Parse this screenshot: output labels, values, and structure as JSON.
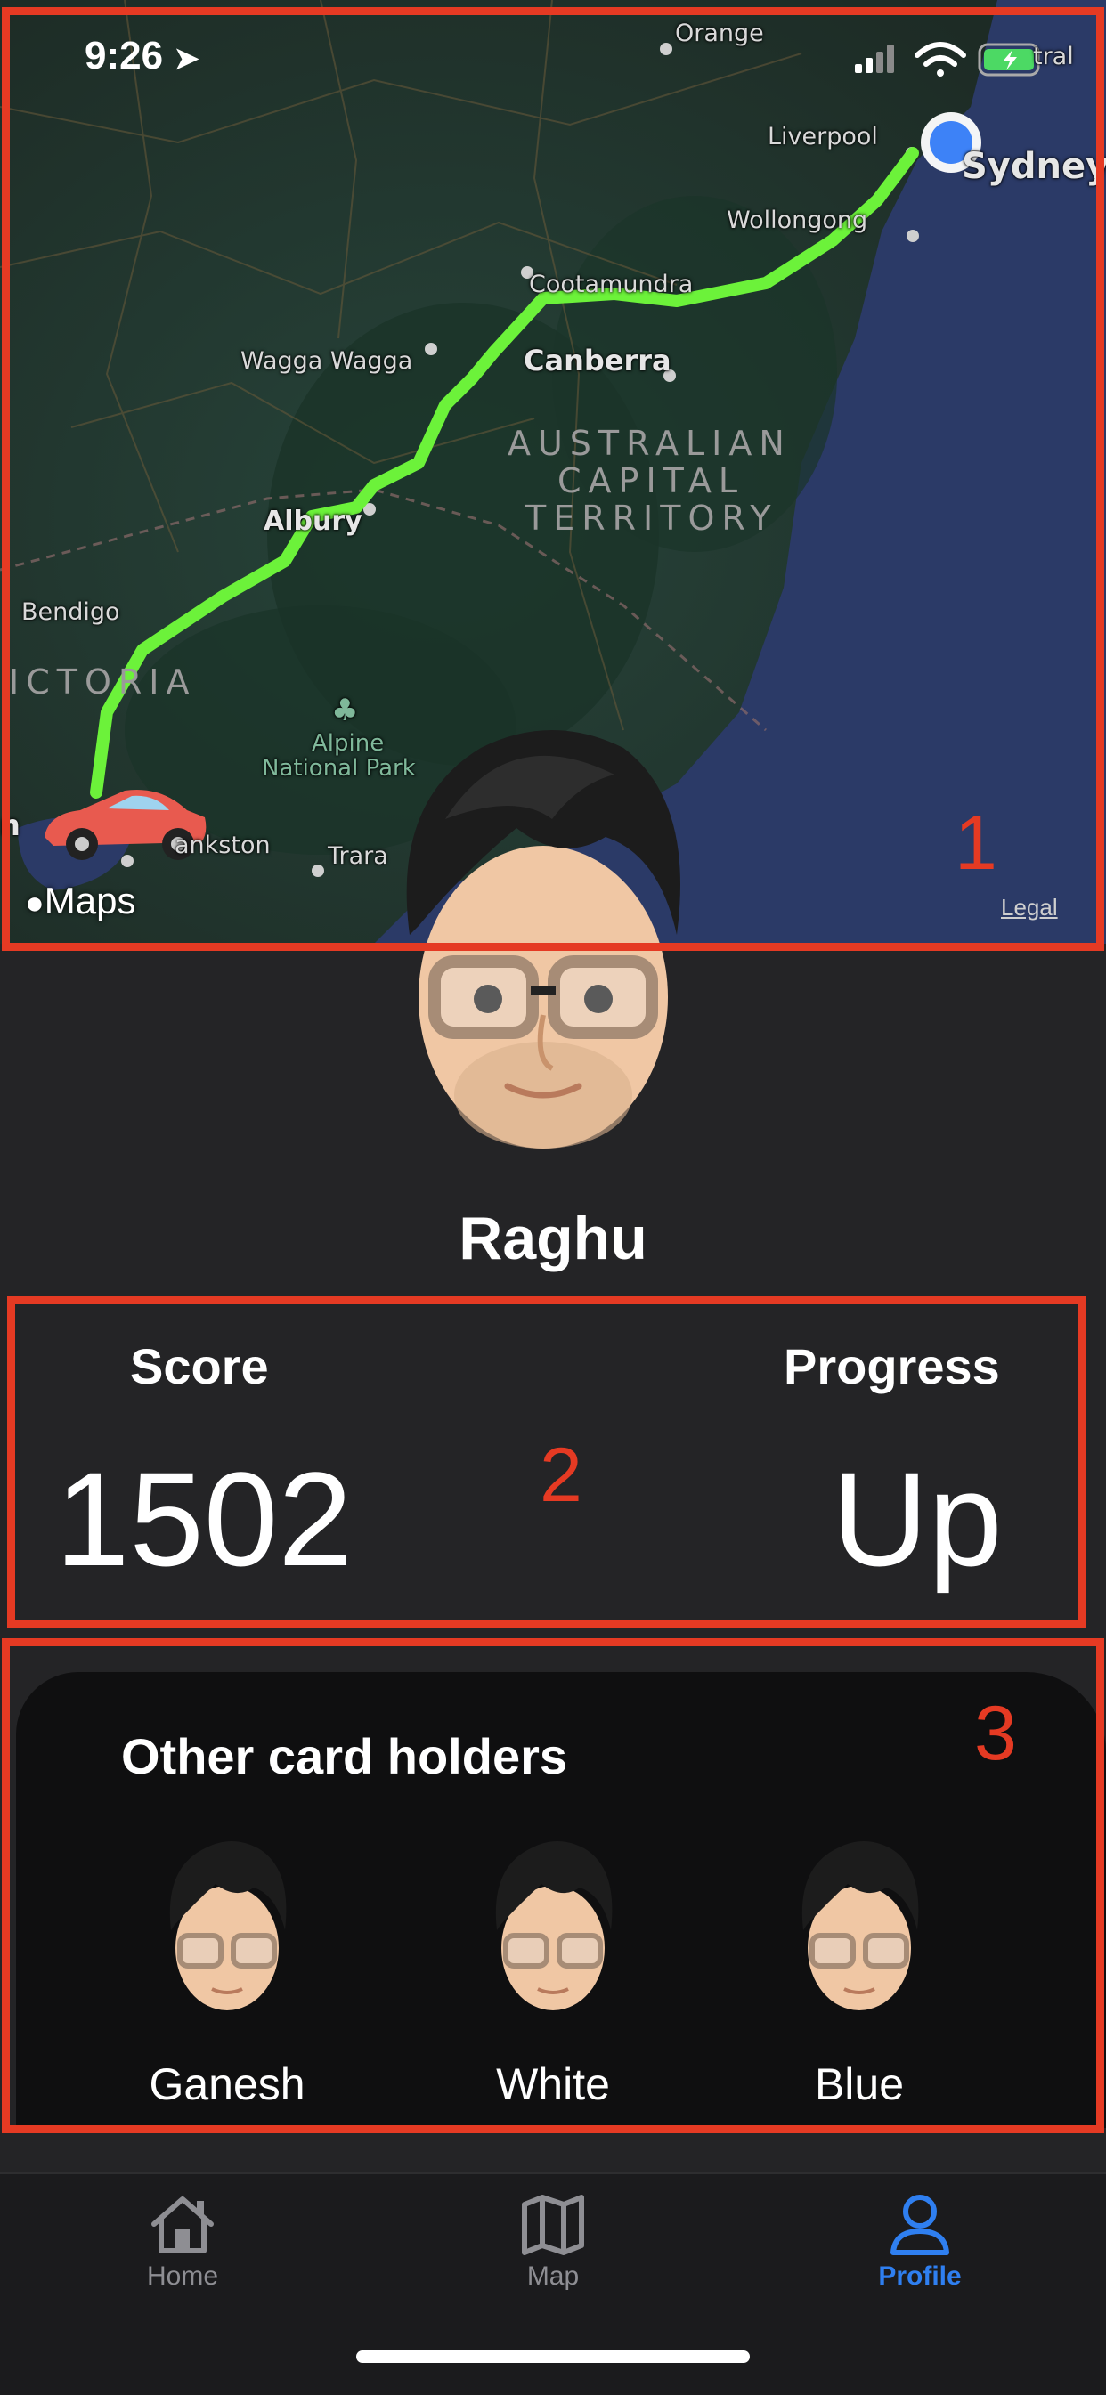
{
  "status_bar": {
    "time": "9:26"
  },
  "map": {
    "labels": {
      "orange": "Orange",
      "liverpool": "Liverpool",
      "sydney": "Sydney",
      "central": "tral",
      "wollongong": "Wollongong",
      "cootamundra": "Cootamundra",
      "wagga": "Wagga Wagga",
      "canberra": "Canberra",
      "act_1": "AUSTRALIAN",
      "act_2": "CAPITAL",
      "act_3": "TERRITORY",
      "albury": "Albury",
      "bendigo": "Bendigo",
      "victoria": "ICTORIA",
      "park_1": "Alpine",
      "park_2": "National Park",
      "frankston": "ankston",
      "traralgon": "Trara",
      "mel": "n"
    },
    "attribution": "Maps",
    "legal": "Legal",
    "route_color": "#6cf23a",
    "location_color": "#3d82f7"
  },
  "profile": {
    "name": "Raghu"
  },
  "stats": {
    "score_label": "Score",
    "score_value": "1502",
    "progress_label": "Progress",
    "progress_value": "Up"
  },
  "holders": {
    "title": "Other card holders",
    "people": [
      {
        "name": "Ganesh"
      },
      {
        "name": "White"
      },
      {
        "name": "Blue"
      }
    ]
  },
  "tabbar": {
    "tabs": [
      {
        "label": "Home",
        "icon": "house-icon"
      },
      {
        "label": "Map",
        "icon": "map-icon"
      },
      {
        "label": "Profile",
        "icon": "person-icon",
        "active": true
      }
    ]
  },
  "annotations": {
    "box1": "1",
    "box2": "2",
    "box3": "3",
    "color": "#e53a23"
  }
}
